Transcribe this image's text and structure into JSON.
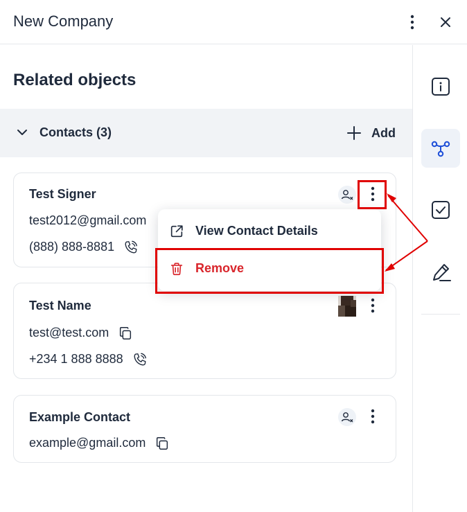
{
  "header": {
    "title": "New Company",
    "more_icon": "kebab-menu-icon",
    "close_icon": "close-icon"
  },
  "main": {
    "section_title": "Related objects",
    "contacts_section": {
      "label": "Contacts (3)",
      "add_label": "Add"
    }
  },
  "contacts": [
    {
      "name": "Test Signer",
      "email": "test2012@gmail.com",
      "phone": "(888) 888-8881"
    },
    {
      "name": "Test Name",
      "email": "test@test.com",
      "phone": "+234 1 888 8888"
    },
    {
      "name": "Example Contact",
      "email": "example@gmail.com"
    }
  ],
  "menu": {
    "items": [
      {
        "label": "View Contact Details",
        "icon": "external-link-icon"
      },
      {
        "label": "Remove",
        "icon": "trash-icon",
        "color": "#d9252b"
      }
    ]
  },
  "sidebar": {
    "items": [
      {
        "icon": "info-icon"
      },
      {
        "icon": "relations-icon",
        "active": true
      },
      {
        "icon": "checkbox-icon"
      },
      {
        "icon": "signature-icon"
      }
    ]
  },
  "colors": {
    "text": "#1f2a3c",
    "accent": "#1e4fd8",
    "danger": "#d9252b",
    "annotation": "#e00000"
  }
}
